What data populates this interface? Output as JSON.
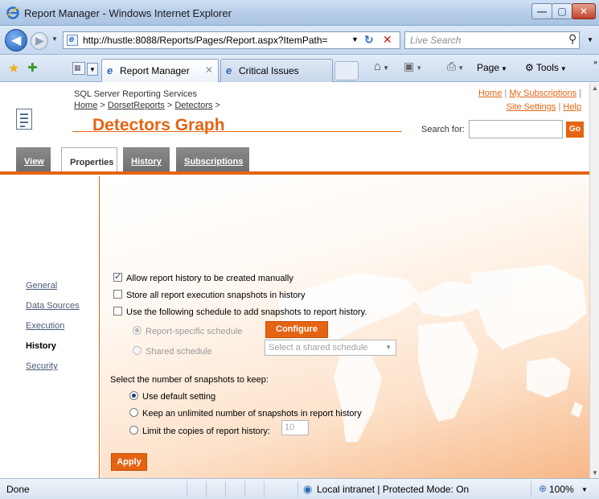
{
  "window": {
    "title": "Report Manager - Windows Internet Explorer",
    "min_glyph": "—",
    "max_glyph": "▢",
    "close_glyph": "✕"
  },
  "addressbar": {
    "url": "http://hustle:8088/Reports/Pages/Report.aspx?ItemPath=",
    "search_placeholder": "Live Search"
  },
  "tabs": [
    {
      "label": "Report Manager",
      "active": true
    },
    {
      "label": "Critical Issues",
      "active": false
    }
  ],
  "commandbar": {
    "page_label": "Page",
    "tools_label": "Tools"
  },
  "header": {
    "product": "SQL Server Reporting Services",
    "breadcrumb": [
      "Home",
      "DorsetReports",
      "Detectors"
    ],
    "title": "Detectors Graph",
    "toplinks": {
      "home": "Home",
      "subscriptions": "My Subscriptions",
      "site_settings": "Site Settings",
      "help": "Help"
    },
    "search_label": "Search for:",
    "go_label": "Go"
  },
  "report_tabs": [
    {
      "label": "View",
      "active": false
    },
    {
      "label": "Properties",
      "active": true
    },
    {
      "label": "History",
      "active": false
    },
    {
      "label": "Subscriptions",
      "active": false
    }
  ],
  "sidebar": {
    "items": [
      {
        "label": "General",
        "current": false
      },
      {
        "label": "Data Sources",
        "current": false
      },
      {
        "label": "Execution",
        "current": false
      },
      {
        "label": "History",
        "current": true
      },
      {
        "label": "Security",
        "current": false
      }
    ]
  },
  "form": {
    "allow_manual": {
      "label": "Allow report history to be created manually",
      "checked": true
    },
    "store_snapshots": {
      "label": "Store all report execution snapshots in history",
      "checked": false
    },
    "use_schedule": {
      "label": "Use the following schedule to add snapshots to report history.",
      "checked": false
    },
    "report_specific": {
      "label": "Report-specific schedule",
      "checked": true,
      "enabled": false
    },
    "configure_label": "Configure",
    "shared_schedule": {
      "label": "Shared schedule",
      "checked": false,
      "enabled": false
    },
    "shared_select_value": "Select a shared schedule",
    "snapshots_heading": "Select the number of snapshots to keep:",
    "keep_default": {
      "label": "Use default setting",
      "checked": true
    },
    "keep_unlimited": {
      "label": "Keep an unlimited number of snapshots in report history",
      "checked": false
    },
    "keep_limit": {
      "label": "Limit the copies of report history:",
      "checked": false
    },
    "limit_value": "10",
    "apply_label": "Apply"
  },
  "statusbar": {
    "status": "Done",
    "zone": "Local intranet | Protected Mode: On",
    "zoom": "100%"
  },
  "colors": {
    "accent": "#e46413",
    "tab_inactive": "#7a7a7a"
  }
}
